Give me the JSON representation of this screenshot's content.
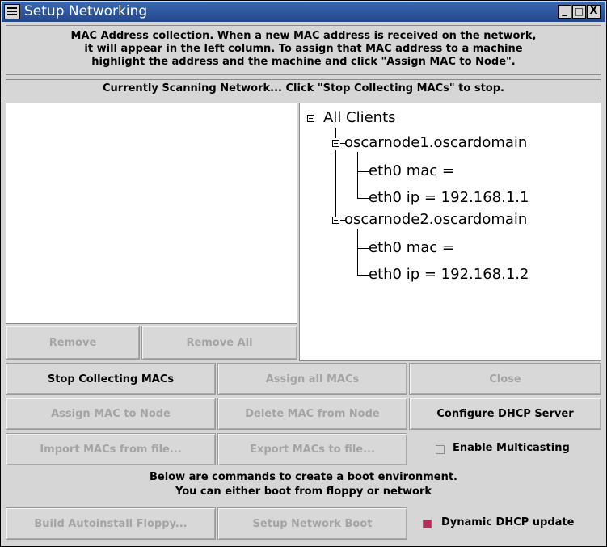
{
  "window": {
    "title": "Setup Networking",
    "controls": {
      "minimize": "_",
      "maximize": "□",
      "close": "X"
    }
  },
  "info_lines": [
    "MAC Address collection.  When a new MAC address is received on the network,",
    "it will appear in the left column.  To assign that MAC address to a machine",
    "highlight the address and the machine and click \"Assign MAC to Node\"."
  ],
  "status": "Currently Scanning Network... Click \"Stop Collecting MACs\" to stop.",
  "mac_list": {
    "items": [],
    "remove_label": "Remove",
    "remove_all_label": "Remove All"
  },
  "tree": {
    "root": "All Clients",
    "nodes": [
      {
        "name": "oscarnode1.oscardomain",
        "mac": "eth0 mac =",
        "ip": "eth0 ip = 192.168.1.1"
      },
      {
        "name": "oscarnode2.oscardomain",
        "mac": "eth0 mac =",
        "ip": "eth0 ip = 192.168.1.2"
      }
    ]
  },
  "buttons": {
    "stop_collecting": "Stop Collecting MACs",
    "assign_all": "Assign all MACs",
    "close": "Close",
    "assign_to_node": "Assign MAC to Node",
    "delete_from_node": "Delete MAC from Node",
    "configure_dhcp": "Configure DHCP Server",
    "import_macs": "Import MACs from file...",
    "export_macs": "Export MACs to file...",
    "build_floppy": "Build Autoinstall Floppy...",
    "setup_network_boot": "Setup Network Boot"
  },
  "checkboxes": {
    "enable_multicasting": {
      "label": "Enable Multicasting",
      "checked": false
    },
    "dynamic_dhcp": {
      "label": "Dynamic DHCP update",
      "checked": true
    }
  },
  "boot_lines": [
    "Below are commands to create a boot environment.",
    "You can either boot from floppy or network"
  ],
  "colors": {
    "titlebar": "#2f5aa0",
    "checked": "#b0305a"
  }
}
